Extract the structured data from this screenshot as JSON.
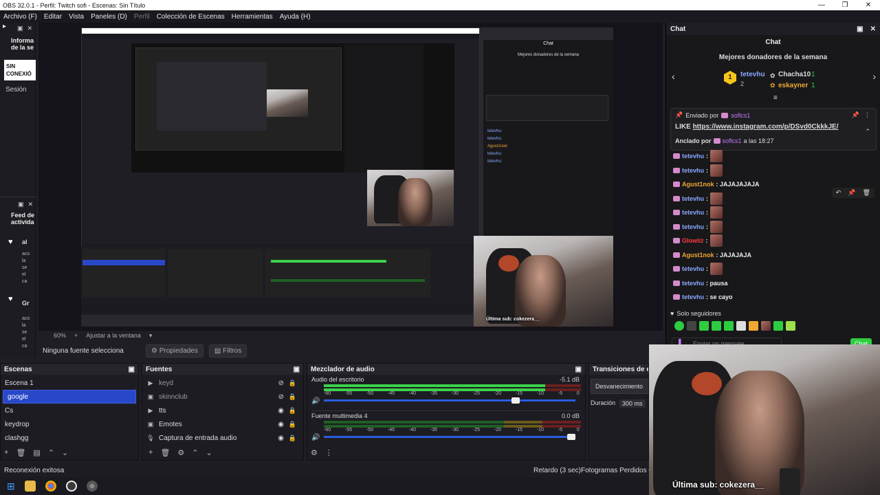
{
  "window": {
    "title": "OBS 32.0.1 - Perfil: Twitch sofi - Escenas: Sin Título",
    "controls": [
      "—",
      "❐",
      "✕"
    ]
  },
  "menu": [
    "Archivo (F)",
    "Editar",
    "Vista",
    "Paneles (D)",
    "Perfil",
    "Colección de Escenas",
    "Herramientas",
    "Ayuda (H)"
  ],
  "left_dock": {
    "top_title": "Informa de la se",
    "badge": "SIN CONEXIÓ",
    "session": "Sesión",
    "feed_title": "Feed de activida",
    "feed_items": [
      {
        "name": "al",
        "lines": [
          "aco",
          "la",
          "se",
          "el",
          "ca"
        ]
      },
      {
        "name": "Gr",
        "lines": [
          "aco",
          "la",
          "se",
          "el",
          "ca"
        ]
      }
    ]
  },
  "preview": {
    "zoom": "60%",
    "fit_label": "Ajustar a la ventana",
    "no_source": "Ninguna fuente selecciona",
    "properties": "Propiedades",
    "filters": "Filtros"
  },
  "scenes": {
    "title": "Escenas",
    "items": [
      "Escena 1",
      "google",
      "Cs",
      "keydrop",
      "clashgg"
    ],
    "selected_index": 1
  },
  "sources": {
    "title": "Fuentes",
    "items": [
      {
        "name": "keyd",
        "icon": "play-icon",
        "visible": false
      },
      {
        "name": "skinnclub",
        "icon": "image-icon",
        "visible": false
      },
      {
        "name": "tts",
        "icon": "play-icon",
        "visible": true
      },
      {
        "name": "Emotes",
        "icon": "image-icon",
        "visible": true
      },
      {
        "name": "Captura de entrada audio",
        "icon": "mic-icon",
        "visible": true
      }
    ]
  },
  "mixer": {
    "title": "Mezclador de audio",
    "channels": [
      {
        "name": "Audio del escritorio",
        "db": "-5.1 dB",
        "level": 0.86,
        "volume": 0.78
      },
      {
        "name": "Fuente multimedia 4",
        "db": "0.0 dB",
        "level": 0.0,
        "volume": 1.0
      }
    ],
    "scale": [
      "-60",
      "-55",
      "-50",
      "-45",
      "-40",
      "-35",
      "-30",
      "-25",
      "-20",
      "-15",
      "-10",
      "-5",
      "0"
    ]
  },
  "transitions": {
    "title": "Transiciones de esc",
    "value": "Desvanecimiento",
    "duration_label": "Duración",
    "duration": "300 ms"
  },
  "status": {
    "message": "Reconexión exitosa",
    "delay": "Retardo (3 sec)",
    "frames": "Fotogramas Perdidos 0 ("
  },
  "chat": {
    "dock_title": "Chat",
    "title": "Chat",
    "donors_title": "Mejores donadores de la semana",
    "donors": [
      {
        "rank": "1",
        "name": "tetevhu",
        "count": "1"
      },
      {
        "rank": "2",
        "name": "",
        "count": ""
      },
      {
        "rank": "",
        "name": "Chacha10",
        "count": "1"
      },
      {
        "rank": "",
        "name": "eskayner",
        "count": "1"
      }
    ],
    "pinned": {
      "sent_by": "Enviado por",
      "sender": "soflcs1",
      "text_prefix": "LIKE",
      "link": "https://www.instagram.com/p/DSvd0CkkkJE/",
      "pinned_by": "Anclado por",
      "pinner": "soflcs1",
      "time": "a las 18:27"
    },
    "messages": [
      {
        "user": "tetevhu",
        "color": "#8aa8ff",
        "text": ":",
        "emote": true
      },
      {
        "user": "tetevhu",
        "color": "#8aa8ff",
        "text": ":",
        "emote": true
      },
      {
        "user": "Agust1nok",
        "color": "#f0a830",
        "text": ": JAJAJAJAJA",
        "emote": false
      },
      {
        "user": "tetevhu",
        "color": "#8aa8ff",
        "text": ":",
        "emote": true
      },
      {
        "user": "tetevhu",
        "color": "#8aa8ff",
        "text": ":",
        "emote": true
      },
      {
        "user": "tetevhu",
        "color": "#8aa8ff",
        "text": ":",
        "emote": true
      },
      {
        "user": "Glowiiz",
        "color": "#ff3b3b",
        "text": ":",
        "emote": true
      },
      {
        "user": "Agust1nok",
        "color": "#f0a830",
        "text": ": JAJAJAJA",
        "emote": false
      },
      {
        "user": "tetevhu",
        "color": "#8aa8ff",
        "text": ":",
        "emote": true
      },
      {
        "user": "tetevhu",
        "color": "#8aa8ff",
        "text": ": pausa",
        "emote": false
      },
      {
        "user": "tetevhu",
        "color": "#8aa8ff",
        "text": ": se cayo",
        "emote": false
      }
    ],
    "followers_only": "Solo seguidores",
    "input_placeholder": "Enviar un mensaje",
    "send_label": "Chat"
  },
  "webcam": {
    "overlay_text": "Última sub: cokezera__"
  },
  "colors": {
    "accent": "#2948c9",
    "twitch_green": "#2ecc40",
    "brand": "#b3472a"
  }
}
